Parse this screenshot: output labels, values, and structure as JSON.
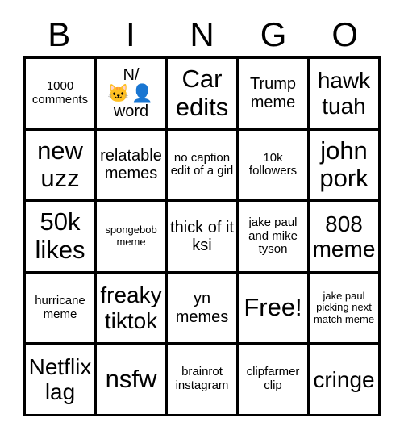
{
  "card": {
    "title": "BINGO",
    "headers": [
      "B",
      "I",
      "N",
      "G",
      "O"
    ],
    "free_space_label": "Free!",
    "colors": {
      "border": "#000000",
      "background": "#ffffff",
      "text": "#000000"
    },
    "rows": [
      [
        {
          "text": "1000 comments",
          "size": "sm"
        },
        {
          "text": "N/",
          "emoji": "🐱👤",
          "text2": "word",
          "size": "md",
          "type": "emoji"
        },
        {
          "text": "Car edits",
          "size": "xl"
        },
        {
          "text": "Trump meme",
          "size": "md"
        },
        {
          "text": "hawk tuah",
          "size": "lg"
        }
      ],
      [
        {
          "text": "new uzz",
          "size": "xl"
        },
        {
          "text": "relatable memes",
          "size": "md"
        },
        {
          "text": "no caption edit of a girl",
          "size": "sm"
        },
        {
          "text": "10k followers",
          "size": "sm"
        },
        {
          "text": "john pork",
          "size": "xl"
        }
      ],
      [
        {
          "text": "50k likes",
          "size": "xl"
        },
        {
          "text": "spongebob meme",
          "size": "xs"
        },
        {
          "text": "thick of it ksi",
          "size": "md"
        },
        {
          "text": "jake paul and mike tyson",
          "size": "sm"
        },
        {
          "text": "808 meme",
          "size": "lg"
        }
      ],
      [
        {
          "text": "hurricane meme",
          "size": "sm"
        },
        {
          "text": "freaky tiktok",
          "size": "lg"
        },
        {
          "text": "yn memes",
          "size": "md"
        },
        {
          "text": "Free!",
          "size": "xl"
        },
        {
          "text": "jake paul picking next match meme",
          "size": "xs"
        }
      ],
      [
        {
          "text": "Netflix lag",
          "size": "lg"
        },
        {
          "text": "nsfw",
          "size": "xl"
        },
        {
          "text": "brainrot instagram",
          "size": "sm"
        },
        {
          "text": "clipfarmer clip",
          "size": "sm"
        },
        {
          "text": "cringe",
          "size": "lg"
        }
      ]
    ]
  }
}
